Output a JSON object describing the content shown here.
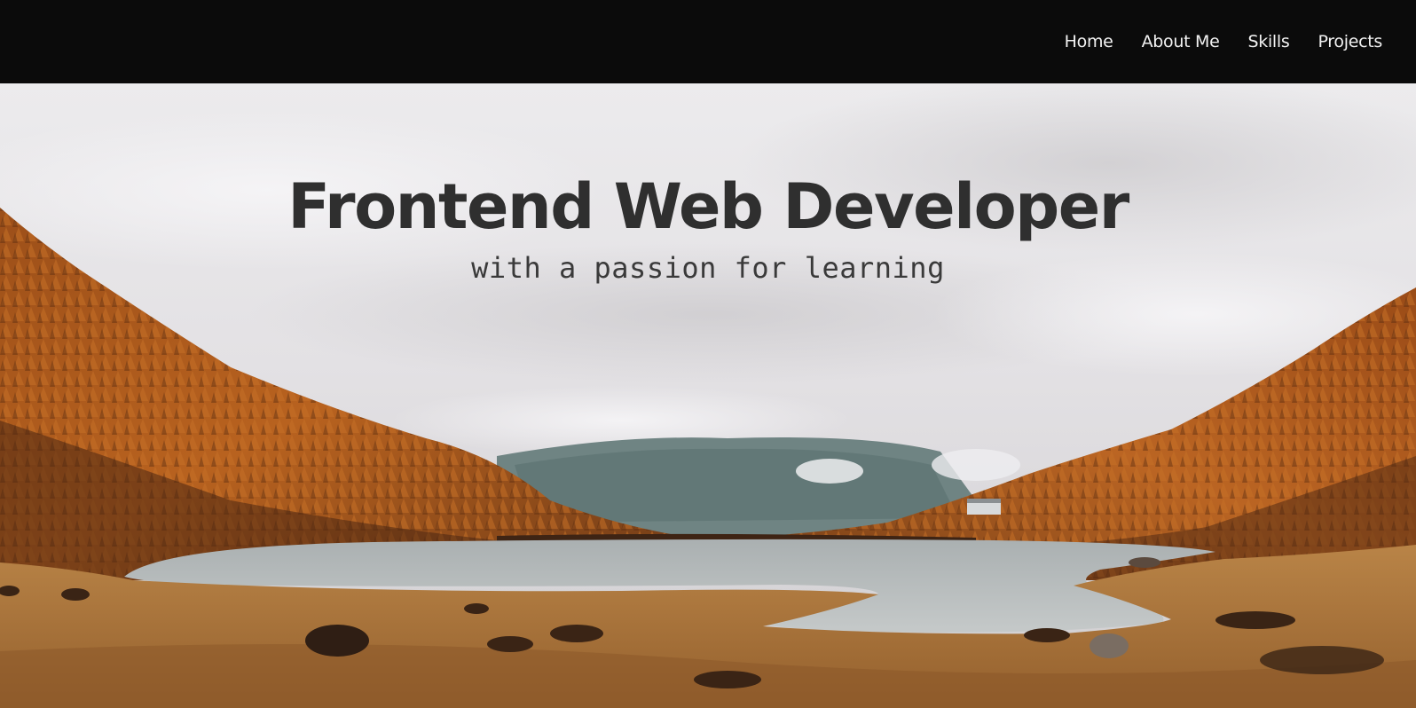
{
  "nav": {
    "items": [
      {
        "label": "Home"
      },
      {
        "label": "About Me"
      },
      {
        "label": "Skills"
      },
      {
        "label": "Projects"
      }
    ]
  },
  "hero": {
    "title": "Frontend Web Developer",
    "subtitle": "with a passion for learning",
    "background": "autumn-larch-forest-lake-landscape"
  },
  "colors": {
    "navbar": "#0b0b0b",
    "nav_text": "#f2f2f2",
    "title": "#2f2f2f",
    "sky": "#e8e6e8",
    "larch": "#b65e1f",
    "lake": "#b7bcbd",
    "meadow": "#b07c3c"
  }
}
